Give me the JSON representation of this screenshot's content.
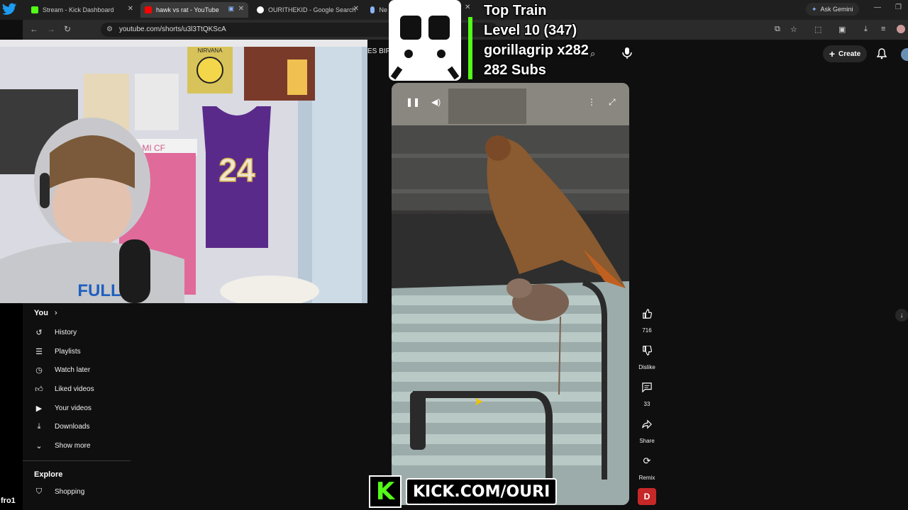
{
  "browser": {
    "tabs": [
      {
        "title": "Stream - Kick Dashboard",
        "color": "#53fc18"
      },
      {
        "title": "hawk vs rat - YouTube",
        "color": "#ff0000"
      },
      {
        "title": "OURITHEKID - Google Search",
        "color": "#4285f4"
      },
      {
        "title": "Ne",
        "color": "#8ab4f8"
      }
    ],
    "ask_gemini": "Ask Gemini",
    "url": "youtube.com/shorts/u3l3TtQKScA"
  },
  "youtube": {
    "header_partial": "ES BIF",
    "create_label": "Create",
    "sidebar": {
      "you_label": "You",
      "items": [
        {
          "label": "History",
          "icon": "history-icon"
        },
        {
          "label": "Playlists",
          "icon": "playlists-icon"
        },
        {
          "label": "Watch later",
          "icon": "watch-later-icon"
        },
        {
          "label": "Liked videos",
          "icon": "liked-videos-icon"
        },
        {
          "label": "Your videos",
          "icon": "your-videos-icon"
        },
        {
          "label": "Downloads",
          "icon": "downloads-icon"
        },
        {
          "label": "Show more",
          "icon": "chevron-down-icon"
        }
      ],
      "explore_label": "Explore",
      "shopping_label": "Shopping"
    },
    "actions": {
      "likes": "716",
      "dislike_label": "Dislike",
      "comments": "33",
      "share_label": "Share",
      "remix_label": "Remix",
      "avatar_letter": "D"
    }
  },
  "overlay": {
    "top_train": "Top Train",
    "level": "Level 10  (347)",
    "gifter": "gorillagrip x282",
    "subs": "282 Subs",
    "kick_url": "KICK.COM/OURI",
    "bottom_left_text": "fro1"
  },
  "webcam": {
    "jersey_number": "24",
    "poster_text": "NIRVANA",
    "banner_text": "R MIAMI CF",
    "hoodie_text": "FULL"
  }
}
